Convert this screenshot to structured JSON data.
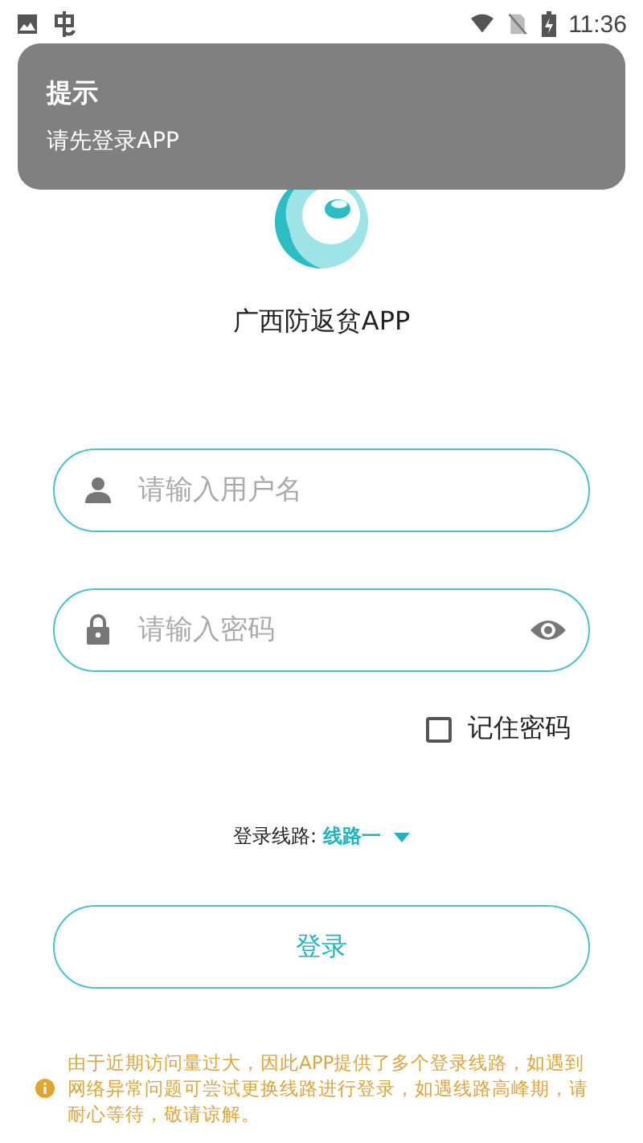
{
  "status_bar": {
    "time": "11:36"
  },
  "toast": {
    "title": "提示",
    "message": "请先登录APP"
  },
  "app_title": "广西防返贫APP",
  "fields": [
    {
      "kind": "user",
      "placeholder": "请输入用户名"
    },
    {
      "kind": "password",
      "placeholder": "请输入密码"
    }
  ],
  "remember": {
    "label": "记住密码",
    "checked": false
  },
  "route": {
    "label": "登录线路:",
    "value": "线路一"
  },
  "login_button": "登录",
  "notice": "由于近期访问量过大，因此APP提供了多个登录线路，如遇到网络异常问题可尝试更换线路进行登录，如遇线路高峰期，请耐心等待，敬请谅解。"
}
